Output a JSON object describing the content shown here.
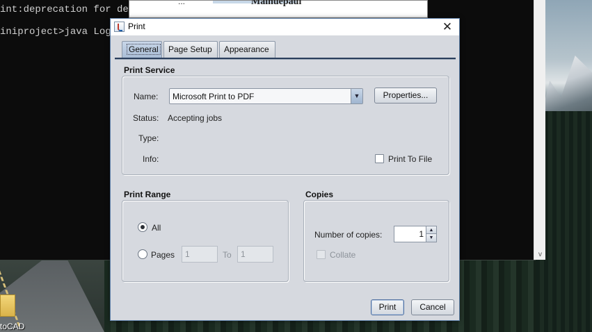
{
  "background": {
    "console": {
      "line1": "int:deprecation for det",
      "line2": "iniproject>java Logi",
      "scroll_arrow": "v"
    },
    "behind_window": {
      "left_text": "...",
      "title": "Mainuepaul"
    },
    "desktop_icon_label": "toCAD"
  },
  "dialog": {
    "title": "Print",
    "close_glyph": "✕",
    "tabs": [
      {
        "label": "General",
        "active": true
      },
      {
        "label": "Page Setup",
        "active": false
      },
      {
        "label": "Appearance",
        "active": false
      }
    ],
    "print_service": {
      "heading": "Print Service",
      "name_label": "Name:",
      "printer": "Microsoft Print to PDF",
      "properties_button": "Properties...",
      "status_label": "Status:",
      "status_value": "Accepting jobs",
      "type_label": "Type:",
      "info_label": "Info:",
      "print_to_file_label": "Print To File",
      "print_to_file_checked": false
    },
    "print_range": {
      "heading": "Print Range",
      "all_label": "All",
      "all_selected": true,
      "pages_label": "Pages",
      "from_value": "1",
      "to_label": "To",
      "to_value": "1"
    },
    "copies": {
      "heading": "Copies",
      "number_label": "Number of copies:",
      "number_value": "1",
      "collate_label": "Collate",
      "collate_enabled": false
    },
    "buttons": {
      "print": "Print",
      "cancel": "Cancel"
    }
  },
  "colors": {
    "dialog_bg": "#d6d9df",
    "active_tab": "#a9bdd6",
    "accent_border": "#5c7fa8"
  }
}
